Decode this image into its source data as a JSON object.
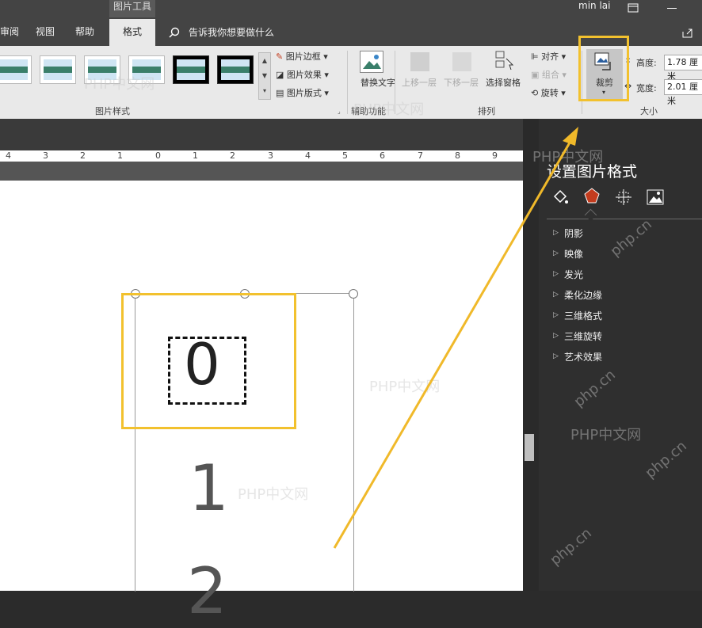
{
  "window": {
    "context_tab_group": "图片工具",
    "user_name": "min lai"
  },
  "tabs": [
    {
      "label": "审阅",
      "active": false
    },
    {
      "label": "视图",
      "active": false
    },
    {
      "label": "帮助",
      "active": false
    },
    {
      "label": "格式",
      "active": true
    }
  ],
  "tell_me": {
    "placeholder": "告诉我你想要做什么"
  },
  "ribbon": {
    "picture_styles": {
      "group_label": "图片样式",
      "border": "图片边框",
      "effects": "图片效果",
      "layout": "图片版式"
    },
    "accessibility": {
      "group_label": "辅助功能",
      "alt_text": "替换文字"
    },
    "arrange": {
      "group_label": "排列",
      "bring_forward": "上移一层",
      "send_backward": "下移一层",
      "selection_pane": "选择窗格",
      "align": "对齐",
      "group": "组合",
      "rotate": "旋转"
    },
    "size": {
      "group_label": "大小",
      "crop": "裁剪",
      "height_label": "高度:",
      "height_value": "1.78 厘米",
      "width_label": "宽度:",
      "width_value": "2.01 厘米"
    }
  },
  "ruler": {
    "labels": [
      "4",
      "3",
      "2",
      "1",
      "0",
      "1",
      "2",
      "3",
      "4",
      "5",
      "6",
      "7",
      "8",
      "9"
    ]
  },
  "pane": {
    "title": "设置图片格式",
    "items": [
      "阴影",
      "映像",
      "发光",
      "柔化边缘",
      "三维格式",
      "三维旋转",
      "艺术效果"
    ]
  },
  "document": {
    "digits": [
      "0",
      "1",
      "2"
    ]
  },
  "watermarks": [
    "PHP中文网",
    "php.cn"
  ],
  "colors": {
    "highlight": "#f2c12e",
    "arrow": "#f0b92a",
    "accent_red": "#c33c1e"
  }
}
